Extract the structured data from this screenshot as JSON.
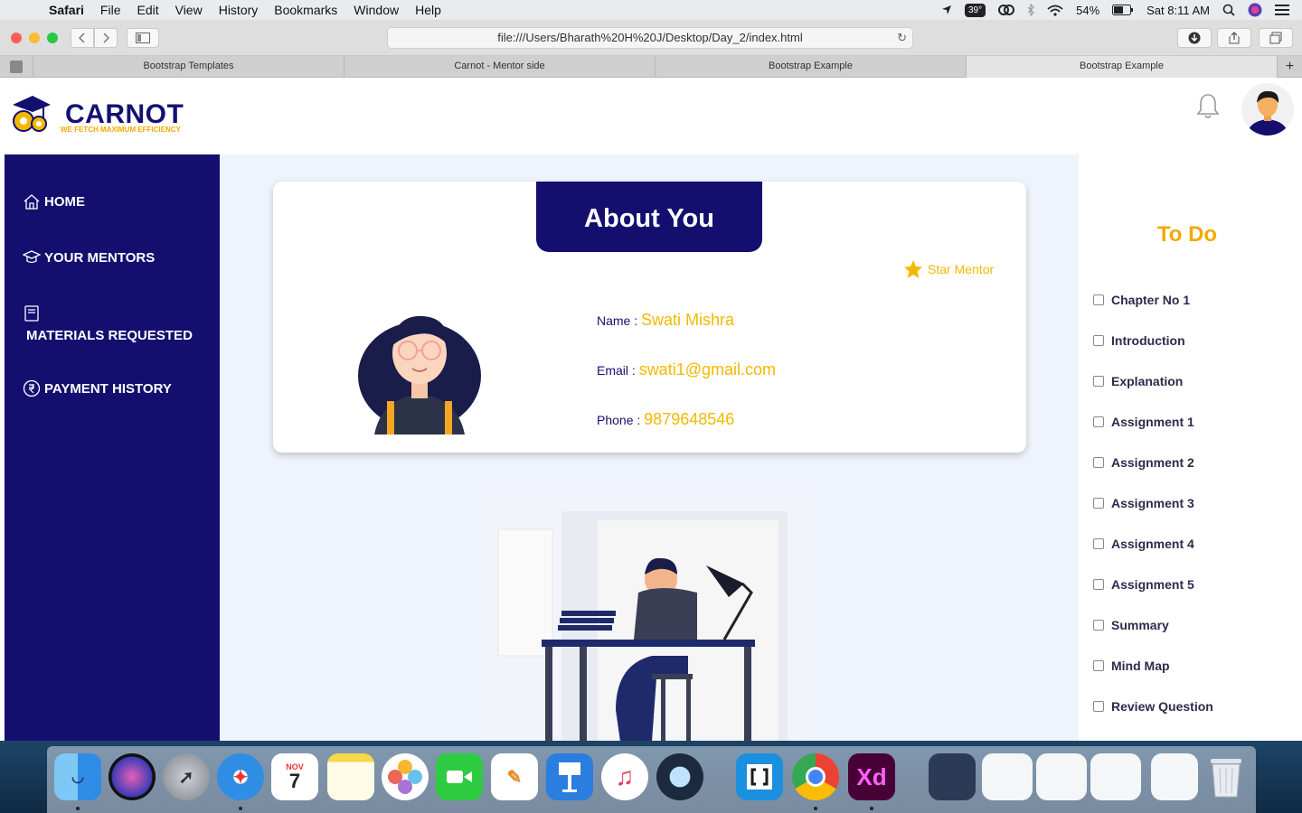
{
  "menubar": {
    "app": "Safari",
    "items": [
      "File",
      "Edit",
      "View",
      "History",
      "Bookmarks",
      "Window",
      "Help"
    ],
    "temperature": "39°",
    "battery": "54%",
    "clock": "Sat 8:11 AM"
  },
  "browser": {
    "url": "file:///Users/Bharath%20H%20J/Desktop/Day_2/index.html",
    "tabs": [
      "Bootstrap Templates",
      "Carnot - Mentor side",
      "Bootstrap Example",
      "Bootstrap Example"
    ]
  },
  "header": {
    "brand": "CARNOT",
    "tagline": "WE FETCH MAXIMUM EFFICIENCY"
  },
  "sidebar": {
    "items": [
      {
        "label": "HOME",
        "icon": "home-icon"
      },
      {
        "label": "YOUR MENTORS",
        "icon": "mentor-cap-icon"
      },
      {
        "label": "MATERIALS REQUESTED",
        "icon": "book-icon"
      },
      {
        "label": "PAYMENT HISTORY",
        "icon": "rupee-icon"
      }
    ]
  },
  "card": {
    "title": "About You",
    "badge": "Star Mentor",
    "name_label": "Name :",
    "name": "Swati Mishra",
    "email_label": "Email :",
    "email": "swati1@gmail.com",
    "phone_label": "Phone :",
    "phone": "9879648546"
  },
  "todo": {
    "title": "To Do",
    "items": [
      "Chapter No 1",
      "Introduction",
      "Explanation",
      "Assignment 1",
      "Assignment 2",
      "Assignment 3",
      "Assignment 4",
      "Assignment 5",
      "Summary",
      "Mind Map",
      "Review Question"
    ]
  },
  "dock": {
    "calendar_month": "NOV",
    "calendar_day": "7",
    "xd_label": "Xd"
  },
  "colors": {
    "navy": "#140f6f",
    "accent": "#f5b800",
    "todo_title": "#f5a800",
    "main_bg": "#eff3fb"
  }
}
